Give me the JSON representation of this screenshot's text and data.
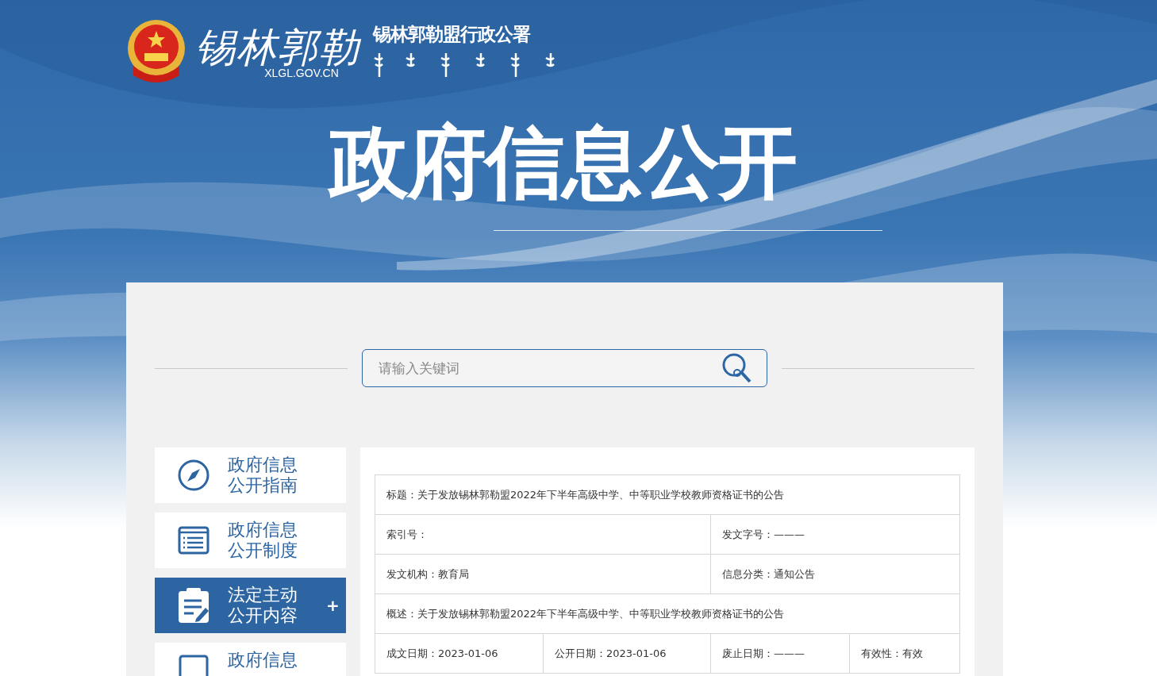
{
  "header": {
    "logo_calligraphy": "锡林郭勒",
    "org_name": "锡林郭勒盟行政公署",
    "domain": "XLGL.GOV.CN",
    "banner_title": "政府信息公开"
  },
  "search": {
    "placeholder": "请输入关键词"
  },
  "sidebar": {
    "items": [
      {
        "kind": "compass",
        "lines": [
          "政府信息",
          "公开指南"
        ],
        "selected": false
      },
      {
        "kind": "list",
        "lines": [
          "政府信息",
          "公开制度"
        ],
        "selected": false
      },
      {
        "kind": "clipboard",
        "lines": [
          "法定主动",
          "公开内容"
        ],
        "selected": true,
        "toggle": "+"
      },
      {
        "kind": "document",
        "lines": [
          "政府信息"
        ],
        "selected": false
      }
    ]
  },
  "info_table": {
    "rows": [
      [
        "标题：关于发放锡林郭勒盟2022年下半年高级中学、中等职业学校教师资格证书的公告"
      ],
      [
        "索引号：",
        "发文字号：———"
      ],
      [
        "发文机构：教育局",
        "信息分类：通知公告"
      ],
      [
        "概述：关于发放锡林郭勒盟2022年下半年高级中学、中等职业学校教师资格证书的公告"
      ],
      [
        "成文日期：2023-01-06",
        "公开日期：2023-01-06",
        "废止日期：———",
        "有效性：有效"
      ]
    ]
  }
}
